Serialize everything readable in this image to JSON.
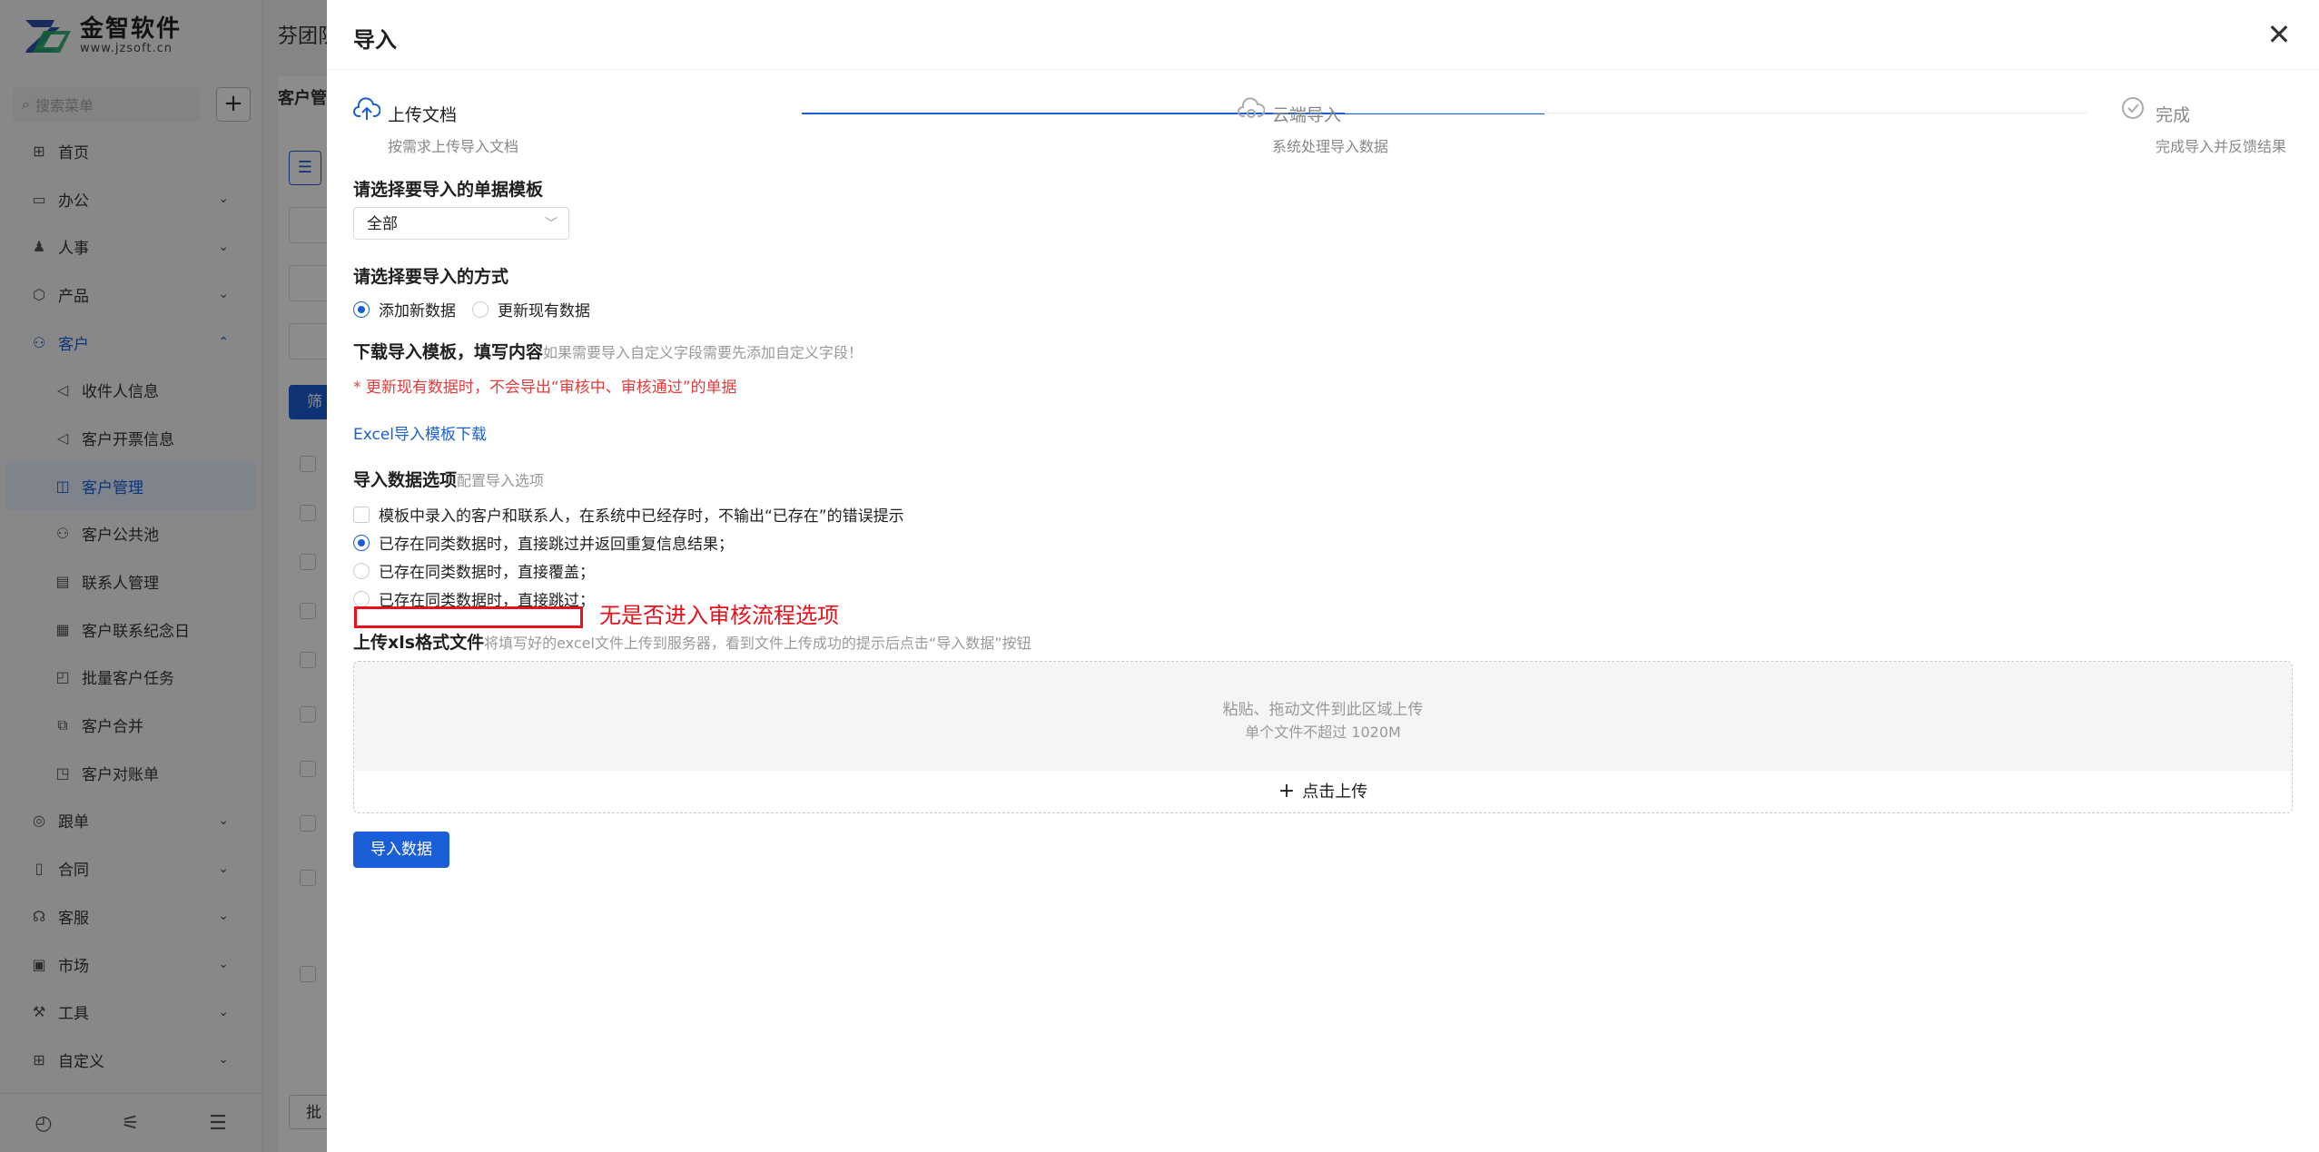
{
  "app": {
    "logo_name": "金智软件",
    "logo_url": "www.jzsoft.cn",
    "search_placeholder": "搜索菜单",
    "company_name": "芬团队",
    "page_title": "客户管",
    "bg_filter_label": "筛",
    "bg_batch_label": "批",
    "menu": [
      {
        "label": "首页",
        "icon": "home-icon",
        "glyph": "⊞",
        "chevron": ""
      },
      {
        "label": "办公",
        "icon": "office-icon",
        "glyph": "▭",
        "chevron": "⌄"
      },
      {
        "label": "人事",
        "icon": "people-icon",
        "glyph": "♟",
        "chevron": "⌄"
      },
      {
        "label": "产品",
        "icon": "product-icon",
        "glyph": "⬡",
        "chevron": "⌄"
      },
      {
        "label": "客户",
        "icon": "customer-icon",
        "glyph": "⚇",
        "chevron": "⌃"
      },
      {
        "label": "收件人信息",
        "icon": "recipient-icon",
        "glyph": "◁",
        "chevron": ""
      },
      {
        "label": "客户开票信息",
        "icon": "invoice-icon",
        "glyph": "◁",
        "chevron": ""
      },
      {
        "label": "客户管理",
        "icon": "customer-manage-icon",
        "glyph": "◫",
        "chevron": ""
      },
      {
        "label": "客户公共池",
        "icon": "public-pool-icon",
        "glyph": "⚇",
        "chevron": ""
      },
      {
        "label": "联系人管理",
        "icon": "contact-icon",
        "glyph": "▤",
        "chevron": ""
      },
      {
        "label": "客户联系纪念日",
        "icon": "anniversary-icon",
        "glyph": "▦",
        "chevron": ""
      },
      {
        "label": "批量客户任务",
        "icon": "batch-task-icon",
        "glyph": "◰",
        "chevron": ""
      },
      {
        "label": "客户合并",
        "icon": "merge-icon",
        "glyph": "⧉",
        "chevron": ""
      },
      {
        "label": "客户对账单",
        "icon": "statement-icon",
        "glyph": "◳",
        "chevron": ""
      },
      {
        "label": "跟单",
        "icon": "follow-icon",
        "glyph": "◎",
        "chevron": "⌄"
      },
      {
        "label": "合同",
        "icon": "contract-icon",
        "glyph": "▯",
        "chevron": "⌄"
      },
      {
        "label": "客服",
        "icon": "service-icon",
        "glyph": "☊",
        "chevron": "⌄"
      },
      {
        "label": "市场",
        "icon": "market-icon",
        "glyph": "▣",
        "chevron": "⌄"
      },
      {
        "label": "工具",
        "icon": "tool-icon",
        "glyph": "⚒",
        "chevron": "⌄"
      },
      {
        "label": "自定义",
        "icon": "custom-icon",
        "glyph": "⊞",
        "chevron": "⌄"
      }
    ]
  },
  "drawer": {
    "title": "导入",
    "steps": [
      {
        "title": "上传文档",
        "desc": "按需求上传导入文档",
        "state": "active"
      },
      {
        "title": "云端导入",
        "desc": "系统处理导入数据",
        "state": "wait"
      },
      {
        "title": "完成",
        "desc": "完成导入并反馈结果",
        "state": "wait"
      }
    ],
    "template_section": {
      "title": "请选择要导入的单据模板",
      "selected": "全部"
    },
    "mode_section": {
      "title": "请选择要导入的方式",
      "options": [
        {
          "label": "添加新数据",
          "checked": true
        },
        {
          "label": "更新现有数据",
          "checked": false
        }
      ]
    },
    "download_section": {
      "title": "下载导入模板，填写内容",
      "hint": "如果需要导入自定义字段需要先添加自定义字段！",
      "warning": "* 更新现有数据时，不会导出“审核中、审核通过”的单据",
      "link": "Excel导入模板下载"
    },
    "options_section": {
      "title": "导入数据选项",
      "hint": "配置导入选项",
      "checkbox_label": "模板中录入的客户和联系人，在系统中已经存时，不输出“已存在”的错误提示",
      "radios": [
        {
          "label": "已存在同类数据时，直接跳过并返回重复信息结果；",
          "checked": true
        },
        {
          "label": "已存在同类数据时，直接覆盖；",
          "checked": false
        },
        {
          "label": "已存在同类数据时，直接跳过；",
          "checked": false
        }
      ]
    },
    "upload_section": {
      "title": "上传xls格式文件",
      "hint": "将填写好的excel文件上传到服务器，看到文件上传成功的提示后点击“导入数据”按钮",
      "drop_line1": "粘贴、拖动文件到此区域上传",
      "drop_line2": "单个文件不超过 1020M",
      "upload_button": "点击上传"
    },
    "import_button": "导入数据"
  },
  "annotation": {
    "text": "无是否进入审核流程选项",
    "color": "#e8101a"
  },
  "colors": {
    "primary": "#1a5fd7",
    "warning": "#e43b3b"
  }
}
